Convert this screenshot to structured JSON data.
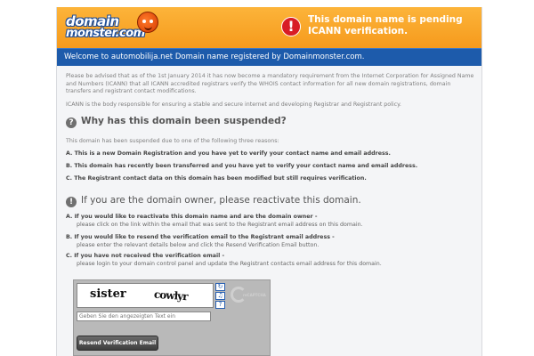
{
  "header": {
    "logo_line1": "domain",
    "logo_line2": "monster.com",
    "alert_icon": "!",
    "alert_line1": "This domain name is pending",
    "alert_line2": "ICANN verification."
  },
  "welcome": {
    "text": "Welcome to automobilija.net Domain name registered by Domainmonster.com."
  },
  "intro": {
    "para1": "Please be advised that as of the 1st January 2014 it has now become a mandatory requirement from the Internet Corporation for Assigned Name and Numbers (ICANN) that all ICANN accredited registrars verify the WHOIS contact information for all new domain registrations, domain transfers and registrant contact modifications.",
    "para2": "ICANN is the body responsible for ensuring a stable and secure internet and developing Registrar and Registrant policy."
  },
  "suspended": {
    "icon": "?",
    "heading": "Why has this domain been suspended?",
    "lead": "This domain has been suspended due to one of the following three reasons:",
    "reasons": [
      "A.  This is a new Domain Registration and you have yet to verify your contact name and email address.",
      "B.  This domain has recently been transferred and you have yet to verify your contact name and email address.",
      "C.  The Registrant contact data on this domain has been modified but still requires verification."
    ]
  },
  "owner": {
    "icon": "!",
    "heading": "If you are the domain owner, please reactivate this domain.",
    "steps": [
      {
        "title": "A.  If you would like to reactivate this domain name and are the domain owner -",
        "sub": "please click on the link within the email that was sent to the Registrant email address on this domain."
      },
      {
        "title": "B.  If you would like to resend the verification email to the Registrant email address -",
        "sub": "please enter the relevant details below and click the Resend Verification Email button."
      },
      {
        "title": "C.  If you have not received the verification email -",
        "sub": "please login to your domain control panel and update the Registrant contacts email address for this domain."
      }
    ]
  },
  "captcha": {
    "word1": "sister",
    "word2": "cowlyr",
    "input_placeholder": "Geben Sie den angezeigten Text ein",
    "reload_icon": "refresh-icon",
    "audio_icon": "audio-icon",
    "help_icon": "help-icon",
    "brand": "reCAPTCHA"
  },
  "resend_button": "Resend Verification Email",
  "colors": {
    "header_orange": "#f69a1c",
    "welcome_blue": "#1d5bab",
    "alert_red": "#d81c24"
  }
}
